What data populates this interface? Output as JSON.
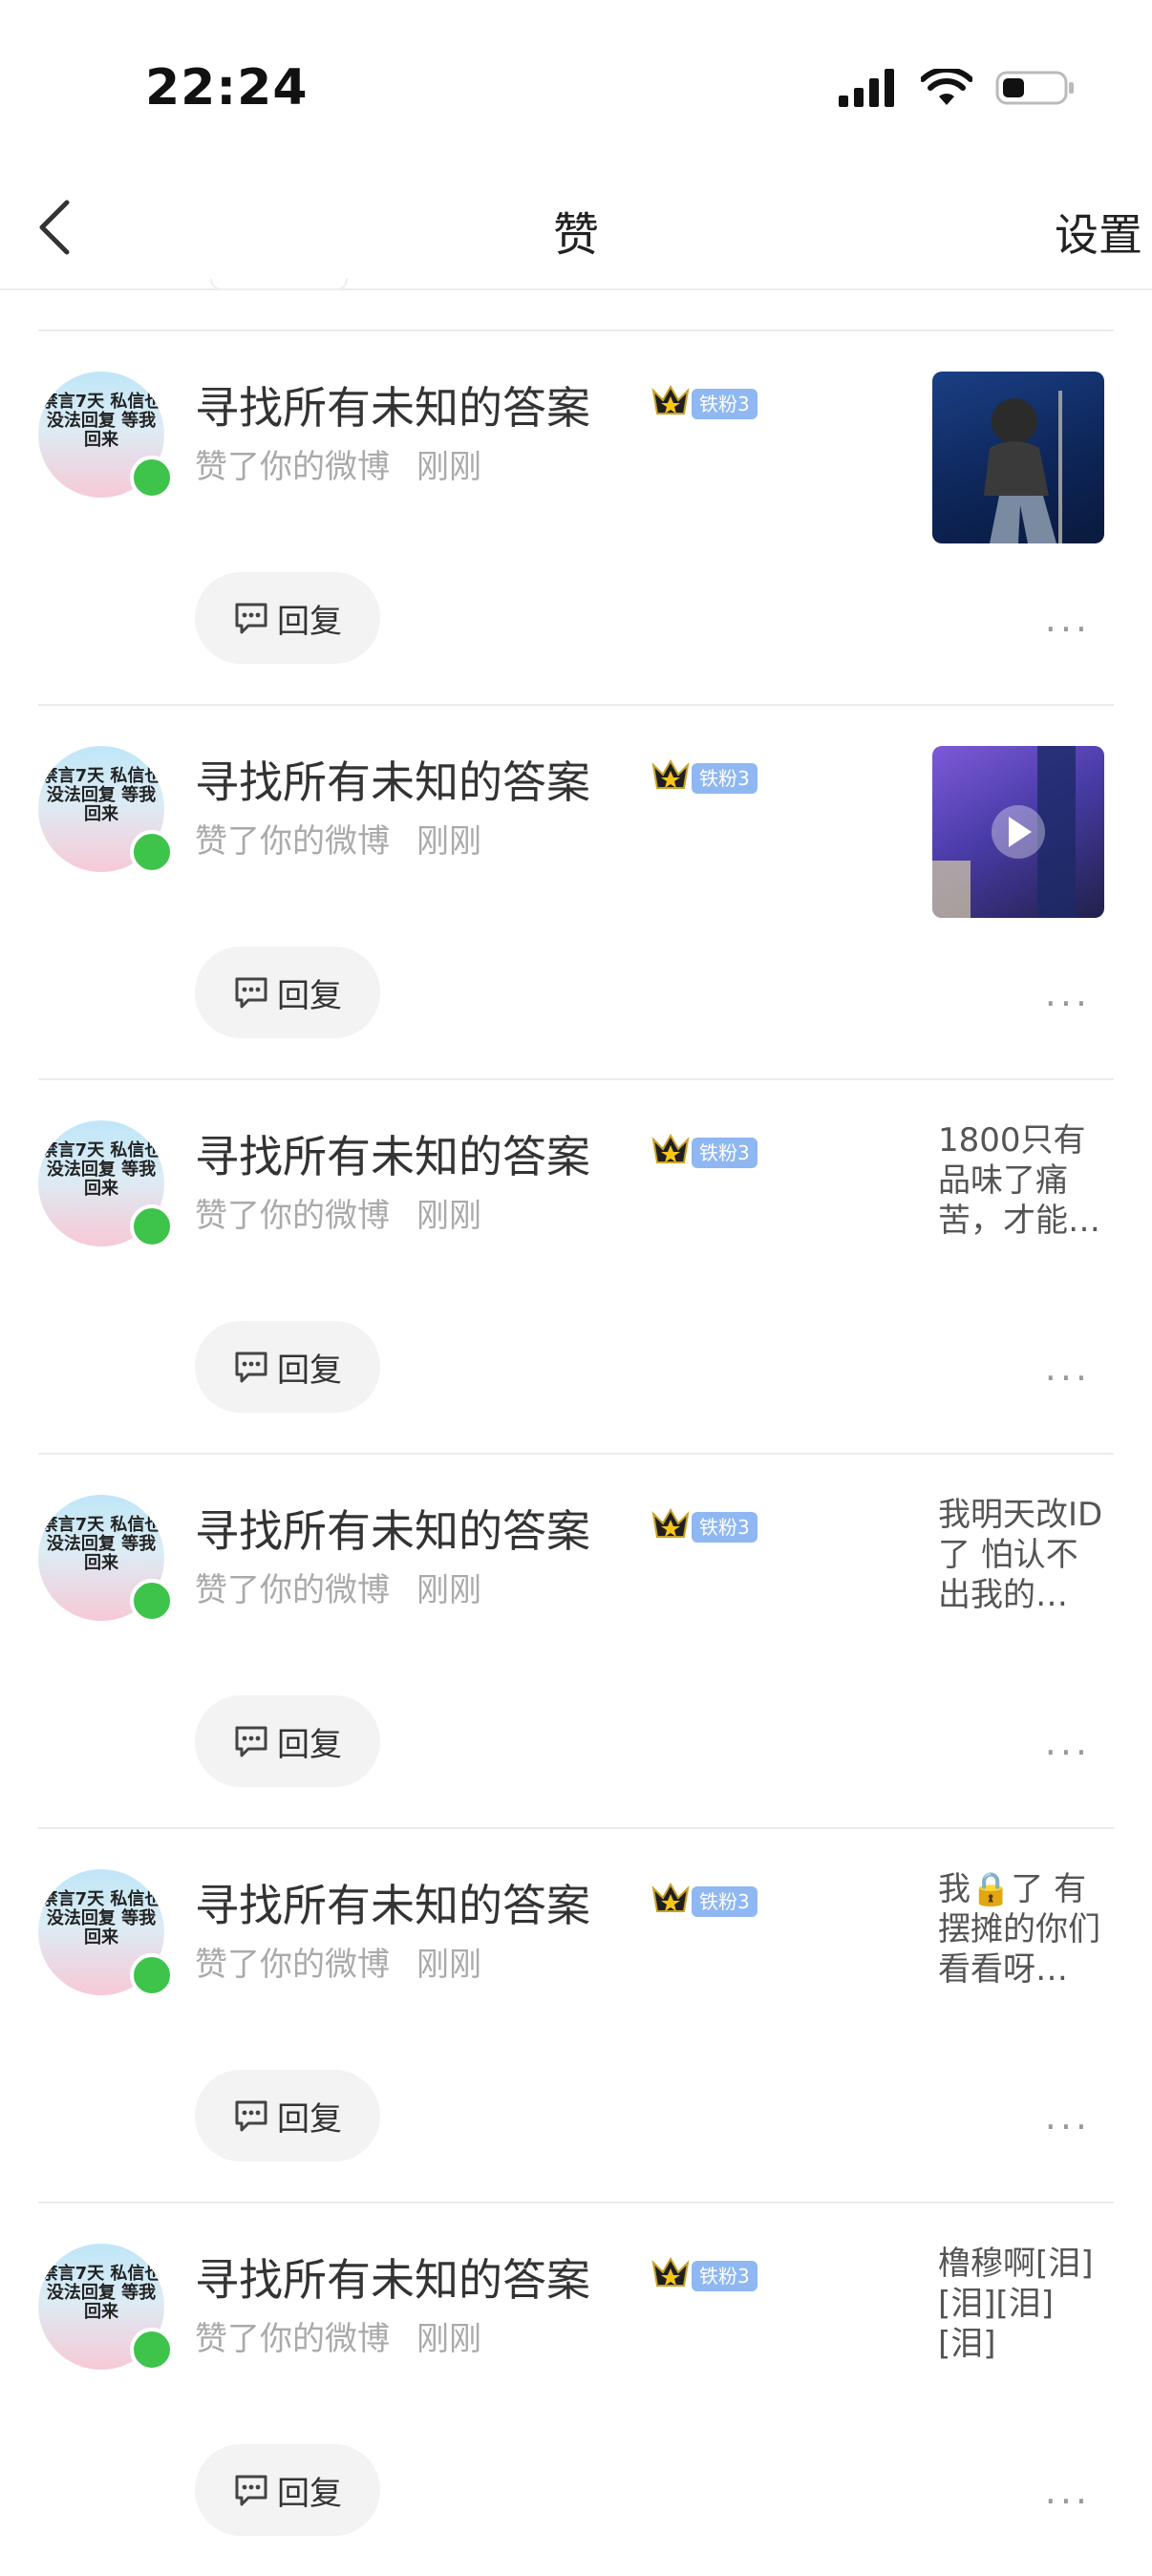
{
  "status_bar": {
    "time": "22:24"
  },
  "nav": {
    "title": "赞",
    "settings": "设置"
  },
  "items": [
    {
      "name": "寻找所有未知的答案",
      "badge": "铁粉3",
      "action": "赞了你的微博",
      "time": "刚刚",
      "avatar_text": "禁言7天 私信也没法回复 等我回来",
      "reply": "回复",
      "more": "···",
      "preview_type": "image"
    },
    {
      "name": "寻找所有未知的答案",
      "badge": "铁粉3",
      "action": "赞了你的微博",
      "time": "刚刚",
      "avatar_text": "禁言7天 私信也没法回复 等我回来",
      "reply": "回复",
      "more": "···",
      "preview_type": "video"
    },
    {
      "name": "寻找所有未知的答案",
      "badge": "铁粉3",
      "action": "赞了你的微博",
      "time": "刚刚",
      "avatar_text": "禁言7天 私信也没法回复 等我回来",
      "reply": "回复",
      "more": "···",
      "preview_type": "text",
      "preview_text": "1800只有品味了痛苦，才能…"
    },
    {
      "name": "寻找所有未知的答案",
      "badge": "铁粉3",
      "action": "赞了你的微博",
      "time": "刚刚",
      "avatar_text": "禁言7天 私信也没法回复 等我回来",
      "reply": "回复",
      "more": "···",
      "preview_type": "text",
      "preview_text": "我明天改ID了 怕认不出我的…"
    },
    {
      "name": "寻找所有未知的答案",
      "badge": "铁粉3",
      "action": "赞了你的微博",
      "time": "刚刚",
      "avatar_text": "禁言7天 私信也没法回复 等我回来",
      "reply": "回复",
      "more": "···",
      "preview_type": "text",
      "preview_text": "我🔒了 有摆摊的你们看看呀…"
    },
    {
      "name": "寻找所有未知的答案",
      "badge": "铁粉3",
      "action": "赞了你的微博",
      "time": "刚刚",
      "avatar_text": "禁言7天 私信也没法回复 等我回来",
      "reply": "回复",
      "more": "···",
      "preview_type": "text",
      "preview_text": "橹穆啊[泪][泪][泪][泪]"
    }
  ]
}
